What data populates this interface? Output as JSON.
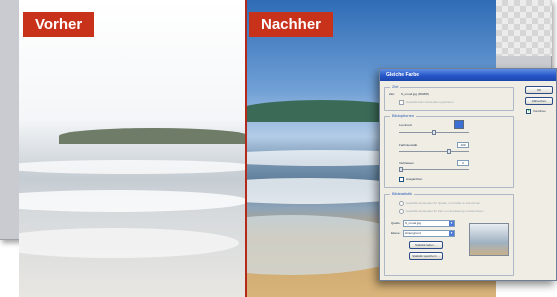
{
  "labels": {
    "before": "Vorher",
    "after": "Nachher"
  },
  "colors": {
    "label_bg": "#c8321b",
    "divider": "#b32a1a",
    "titlebar": "#2657c9"
  },
  "dialog": {
    "title": "Gleiche Farbe",
    "target": {
      "legend": "Ziel",
      "row_label": "Ziel:",
      "row_value": "S_mood.jpg (RGB/8)",
      "ignore_selection": "Auswahl beim Anwenden ignorieren"
    },
    "image_options": {
      "legend": "Bildoptionen",
      "luminance": {
        "label": "Luminanz",
        "value": ""
      },
      "color_intensity": {
        "label": "Farbintensität",
        "value": "100"
      },
      "fade": {
        "label": "Verblassen",
        "value": "0"
      },
      "neutralize_label": "Ausgleichen",
      "neutralize_checked": false
    },
    "statistics": {
      "legend": "Bildstatistik",
      "use_selection_source": "Auswahl verwenden für Quelle, um Farbe zu berechnen",
      "use_selection_target": "Auswahl verwenden für Ziel, um Anpassung zu berechnen",
      "source_label": "Quelle:",
      "source_value": "S_mood.jpg",
      "layer_label": "Ebene:",
      "layer_value": "Hintergrund",
      "load_button": "Statistik laden ...",
      "save_button": "Statistik speichern ..."
    },
    "buttons": {
      "ok": "OK",
      "reset": "Abbrechen",
      "preview": "Vorschau"
    },
    "preview_checked": true
  }
}
